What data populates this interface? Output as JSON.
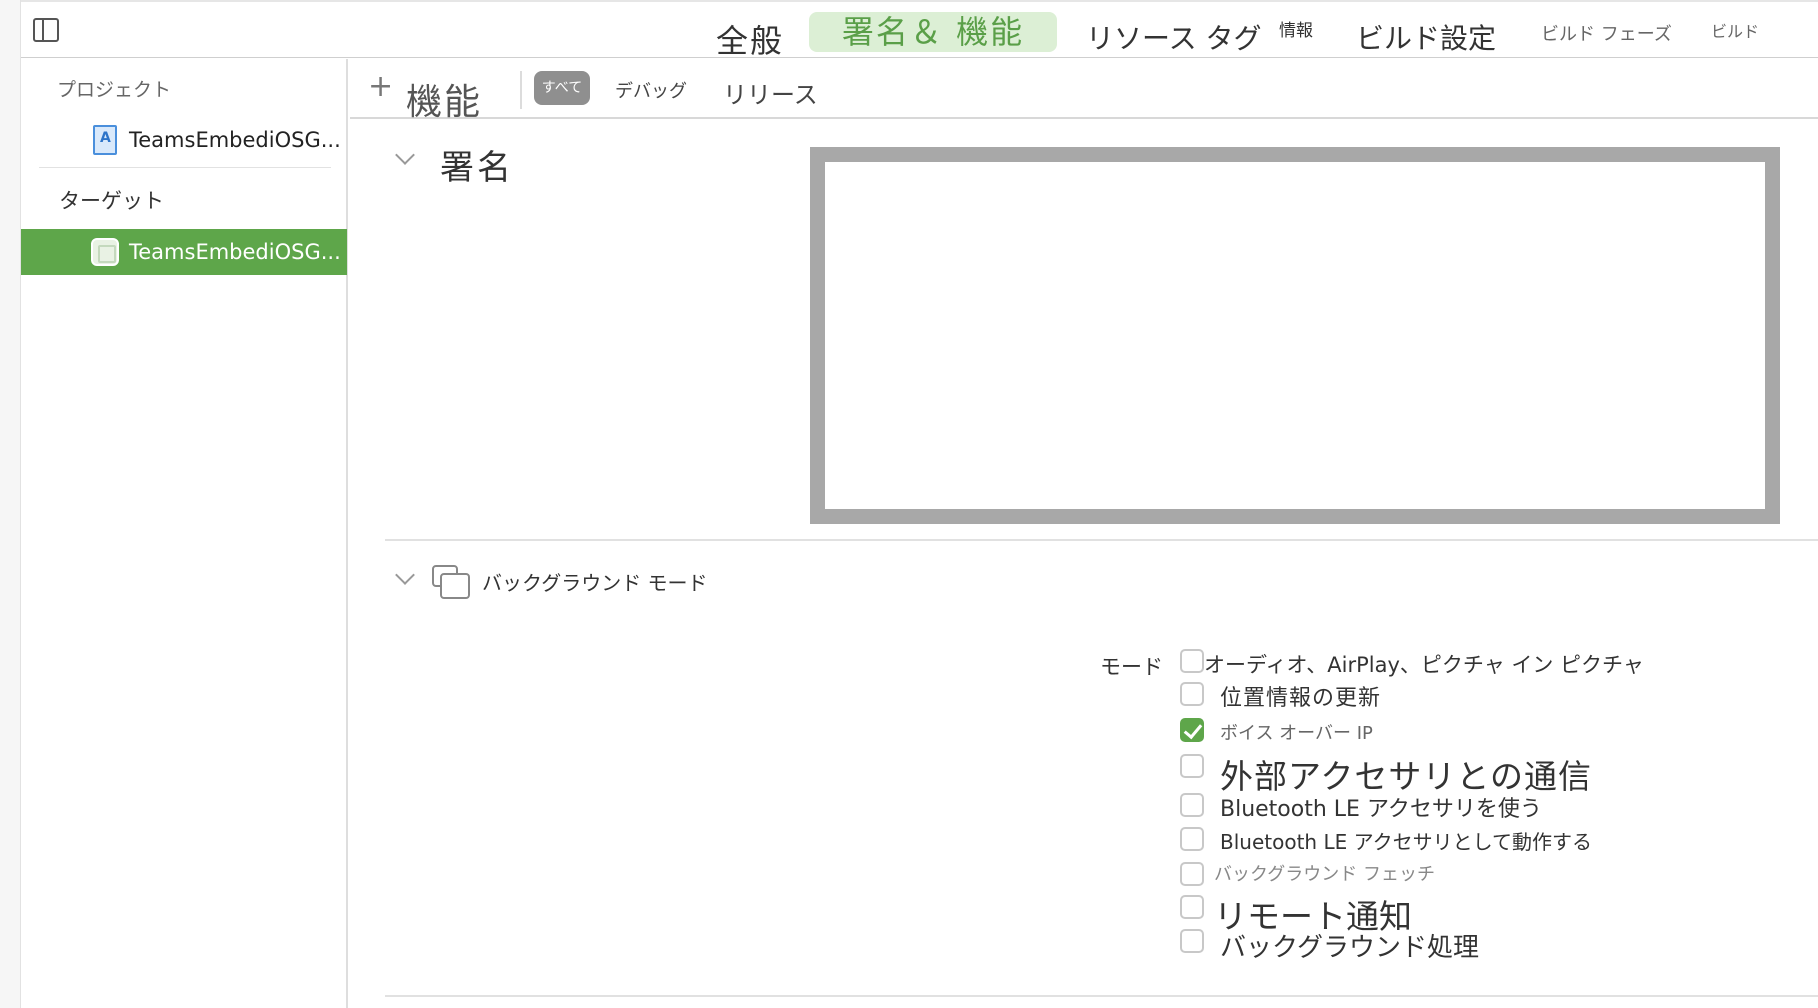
{
  "tabs": {
    "general": "全般",
    "signing_capabilities": "署名＆ 機能",
    "resource_tags": "リソース タグ",
    "info": "情報",
    "build_settings": "ビルド設定",
    "build_phases": "ビルド フェーズ",
    "build_rules": "ビルド"
  },
  "sidebar": {
    "project_section": "プロジェクト",
    "project_item": "TeamsEmbediOSG...",
    "targets_section": "ターゲット",
    "target_item": "TeamsEmbediOSG..."
  },
  "filterbar": {
    "add": "+",
    "capability_label": "機能",
    "all": "すべて",
    "debug": "デバッグ",
    "release": "リリース"
  },
  "signing": {
    "title": "署名"
  },
  "background_modes": {
    "title": "バックグラウンド モード",
    "modes_label": "モード",
    "options": [
      {
        "label": "オーディオ、AirPlay、ピクチャ イン ピクチャ",
        "checked": false
      },
      {
        "label": "位置情報の更新",
        "checked": false
      },
      {
        "label": "ボイス オーバー IP",
        "checked": true
      },
      {
        "label": "外部アクセサリとの通信",
        "checked": false
      },
      {
        "label": "Bluetooth LE アクセサリを使う",
        "checked": false
      },
      {
        "label": "Bluetooth LE アクセサリとして動作する",
        "checked": false
      },
      {
        "label": "バックグラウンド フェッチ",
        "checked": false
      },
      {
        "label": "リモート通知",
        "checked": false
      },
      {
        "label": "バックグラウンド処理",
        "checked": false
      }
    ]
  },
  "colors": {
    "accent": "#5ea64a",
    "active_tab_bg": "#dcefd5",
    "signing_box_border": "#a8a8a8"
  }
}
